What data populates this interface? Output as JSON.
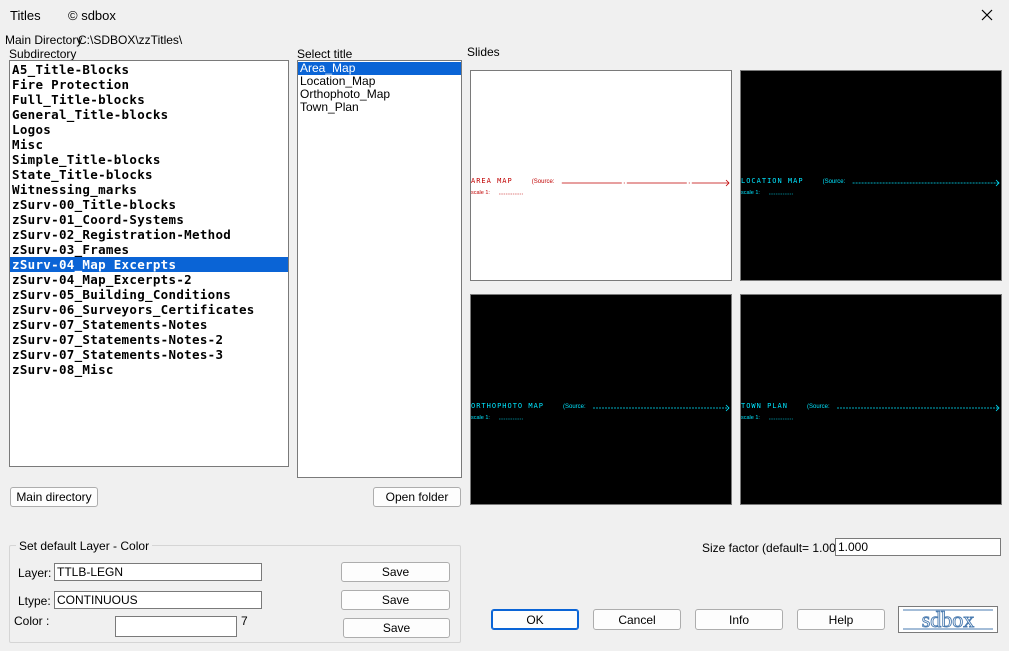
{
  "window": {
    "title": "Titles",
    "copyright": "© sdbox"
  },
  "main_directory": {
    "label": "Main Directory",
    "path": "C:\\SDBOX\\zzTitles\\"
  },
  "subdirectory": {
    "label": "Subdirectory",
    "items": [
      "A5_Title-Blocks",
      "Fire Protection",
      "Full_Title-blocks",
      "General_Title-blocks",
      "Logos",
      "Misc",
      "Simple_Title-blocks",
      "State_Title-blocks",
      "Witnessing_marks",
      "zSurv-00_Title-blocks",
      "zSurv-01_Coord-Systems",
      "zSurv-02_Registration-Method",
      "zSurv-03_Frames",
      "zSurv-04_Map Excerpts",
      "zSurv-04_Map_Excerpts-2",
      "zSurv-05_Building_Conditions",
      "zSurv-06_Surveyors_Certificates",
      "zSurv-07_Statements-Notes",
      "zSurv-07_Statements-Notes-2",
      "zSurv-07_Statements-Notes-3",
      "zSurv-08_Misc"
    ],
    "selected_index": 13
  },
  "select_title": {
    "label": "Select title",
    "items": [
      "Area_Map",
      "Location_Map",
      "Orthophoto_Map",
      "Town_Plan"
    ],
    "selected_index": 0
  },
  "slides": {
    "label": "Slides",
    "items": [
      {
        "title": "AREA  MAP",
        "source": "(Source:",
        "scale": "scale 1:",
        "color": "#c00000",
        "bg": "#ffffff"
      },
      {
        "title": "LOCATION  MAP",
        "source": "(Source:",
        "scale": "scale 1:",
        "color": "#00e5ff",
        "bg": "#000000"
      },
      {
        "title": "ORTHOPHOTO  MAP",
        "source": "(Source:",
        "scale": "scale 1:",
        "color": "#00e5ff",
        "bg": "#000000"
      },
      {
        "title": "TOWN  PLAN",
        "source": "(Source:",
        "scale": "scale 1:",
        "color": "#00e5ff",
        "bg": "#000000"
      }
    ]
  },
  "buttons": {
    "main_directory": "Main directory",
    "open_folder": "Open folder",
    "save": "Save",
    "ok": "OK",
    "cancel": "Cancel",
    "info": "Info",
    "help": "Help"
  },
  "layer_group": {
    "title": "Set default Layer - Color",
    "layer_label": "Layer:",
    "layer_value": "TTLB-LEGN",
    "ltype_label": "Ltype:",
    "ltype_value": "CONTINUOUS",
    "color_label": "Color  :",
    "color_value": "",
    "color_number": "7"
  },
  "size_factor": {
    "label": "Size factor  (default= 1.00):",
    "value": "1.000"
  },
  "logo": {
    "text": "sdbox"
  },
  "colors": {
    "selection": "#0a64d6",
    "default_border": "#0a64d6"
  }
}
